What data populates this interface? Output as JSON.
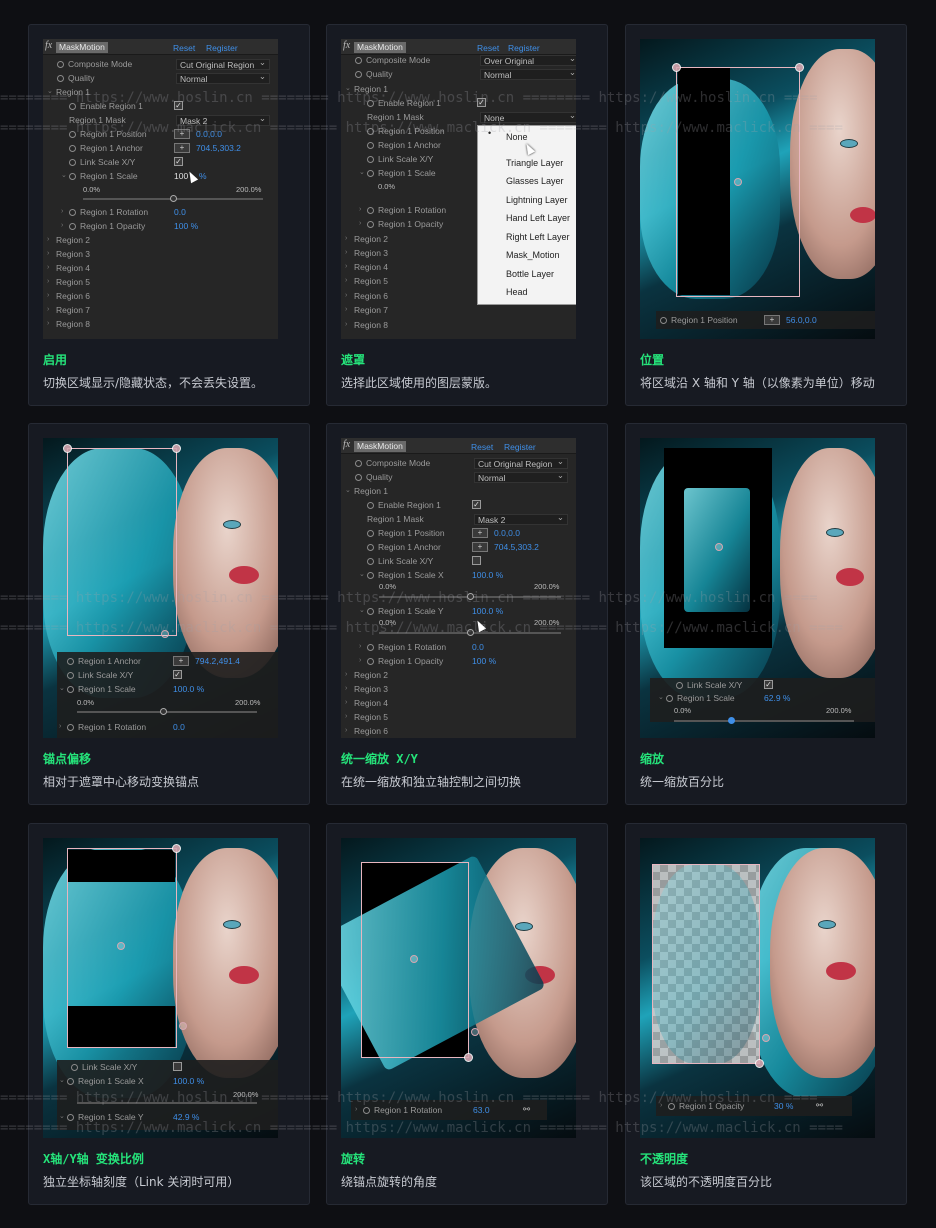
{
  "watermarks": {
    "line1": "======== https://www.hoslin.cn ======== https://www.hoslin.cn ======== https://www.hoslin.cn ====",
    "line2": "======== https://www.maclick.cn ======== https://www.maclick.cn ======== https://www.maclick.cn ===="
  },
  "panel": {
    "fx": "fx",
    "effect_name": "MaskMotion",
    "reset": "Reset",
    "register": "Register",
    "composite_mode": "Composite Mode",
    "quality": "Quality",
    "region1": "Region 1",
    "enable_region1": "Enable Region 1",
    "region1_mask": "Region 1 Mask",
    "region1_position": "Region 1 Position",
    "region1_anchor": "Region 1 Anchor",
    "link_scale": "Link Scale X/Y",
    "region1_scale": "Region 1 Scale",
    "region1_scale_x": "Region 1 Scale X",
    "region1_scale_y": "Region 1 Scale Y",
    "region1_rotation": "Region 1 Rotation",
    "region1_opacity": "Region 1 Opacity",
    "regions": [
      "Region 2",
      "Region 3",
      "Region 4",
      "Region 5",
      "Region 6",
      "Region 7",
      "Region 8"
    ],
    "tick_min": "0.0%",
    "tick_max": "200.0%",
    "pct": "%"
  },
  "cards": [
    {
      "title": "启用",
      "desc": "切换区域显示/隐藏状态，不会丢失设置。",
      "composite": "Cut Original Region",
      "quality": "Normal",
      "mask": "Mask 2",
      "position": "0.0,0.0",
      "anchor": "704.5,303.2",
      "scale": "100",
      "rotation": "0.0",
      "opacity": "100"
    },
    {
      "title": "遮罩",
      "desc": "选择此区域使用的图层蒙版。",
      "composite": "Over Original",
      "quality": "Normal",
      "mask": "None",
      "menu": [
        "None",
        "Triangle Layer",
        "Glasses Layer",
        "Lightning Layer",
        "Hand Left Layer",
        "Right Left Layer",
        "Mask_Motion",
        "Bottle Layer",
        "Head"
      ]
    },
    {
      "title": "位置",
      "desc": "将区域沿 X 轴和 Y 轴（以像素为单位）移动",
      "position": "56.0,0.0"
    },
    {
      "title": "锚点偏移",
      "desc": "相对于遮罩中心移动变换锚点",
      "anchor": "794.2,491.4",
      "scale": "100.0",
      "rotation": "0.0"
    },
    {
      "title": "统一缩放 X/Y",
      "desc": "在统一缩放和独立轴控制之间切换",
      "composite": "Cut Original Region",
      "quality": "Normal",
      "mask": "Mask 2",
      "position": "0.0,0.0",
      "anchor": "704.5,303.2",
      "scale_x": "100.0",
      "scale_y": "100.0",
      "rotation": "0.0",
      "opacity": "100"
    },
    {
      "title": "缩放",
      "desc": "统一缩放百分比",
      "scale": "62.9"
    },
    {
      "title": "X轴/Y轴 变换比例",
      "desc": "独立坐标轴刻度（Link 关闭时可用）",
      "scale_x": "100.0",
      "scale_y": "42.9"
    },
    {
      "title": "旋转",
      "desc": "绕锚点旋转的角度",
      "rotation": "63.0"
    },
    {
      "title": "不透明度",
      "desc": "该区域的不透明度百分比",
      "opacity": "30"
    }
  ]
}
